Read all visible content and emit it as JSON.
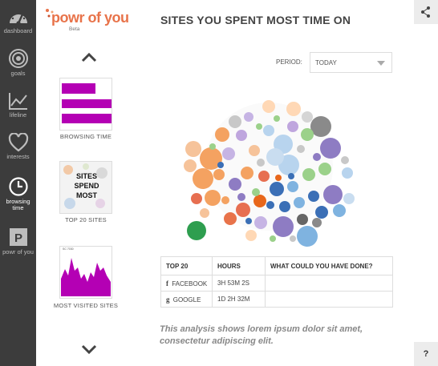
{
  "nav": {
    "items": [
      {
        "id": "dashboard",
        "label": "dashboard"
      },
      {
        "id": "goals",
        "label": "goals"
      },
      {
        "id": "lifeline",
        "label": "lifeline"
      },
      {
        "id": "interests",
        "label": "interests"
      },
      {
        "id": "browsing",
        "label": "browsing time"
      },
      {
        "id": "powr",
        "label": "powr of you"
      }
    ]
  },
  "logo": {
    "text": "powr of you",
    "beta": "Beta"
  },
  "header": {
    "title": "SITES YOU SPENT MOST TIME ON"
  },
  "thumbnails": [
    {
      "label": "BROWSING TIME"
    },
    {
      "label": "TOP 20 SITES",
      "overlay": "SITES SPEND MOST"
    },
    {
      "label": "MOST VISITED SITES",
      "mini_title": "SC 7030"
    }
  ],
  "period": {
    "label": "PERIOD:",
    "value": "TODAY"
  },
  "table": {
    "headers": [
      "TOP 20",
      "HOURS",
      "WHAT COULD YOU HAVE DONE?"
    ],
    "rows": [
      {
        "icon": "f",
        "site": "FACEBOOK",
        "hours": "3H 53M 2S",
        "alt": ""
      },
      {
        "icon": "g",
        "site": "GOOGLE",
        "hours": "1D 2H 32M",
        "alt": ""
      }
    ]
  },
  "note": "This analysis shows lorem ipsum dolor sit amet, consectetur adipiscing elit.",
  "help": "?",
  "colors": {
    "nav_bg": "#3c3c3c",
    "accent": "#b400b4",
    "logo": "#e8734a"
  }
}
